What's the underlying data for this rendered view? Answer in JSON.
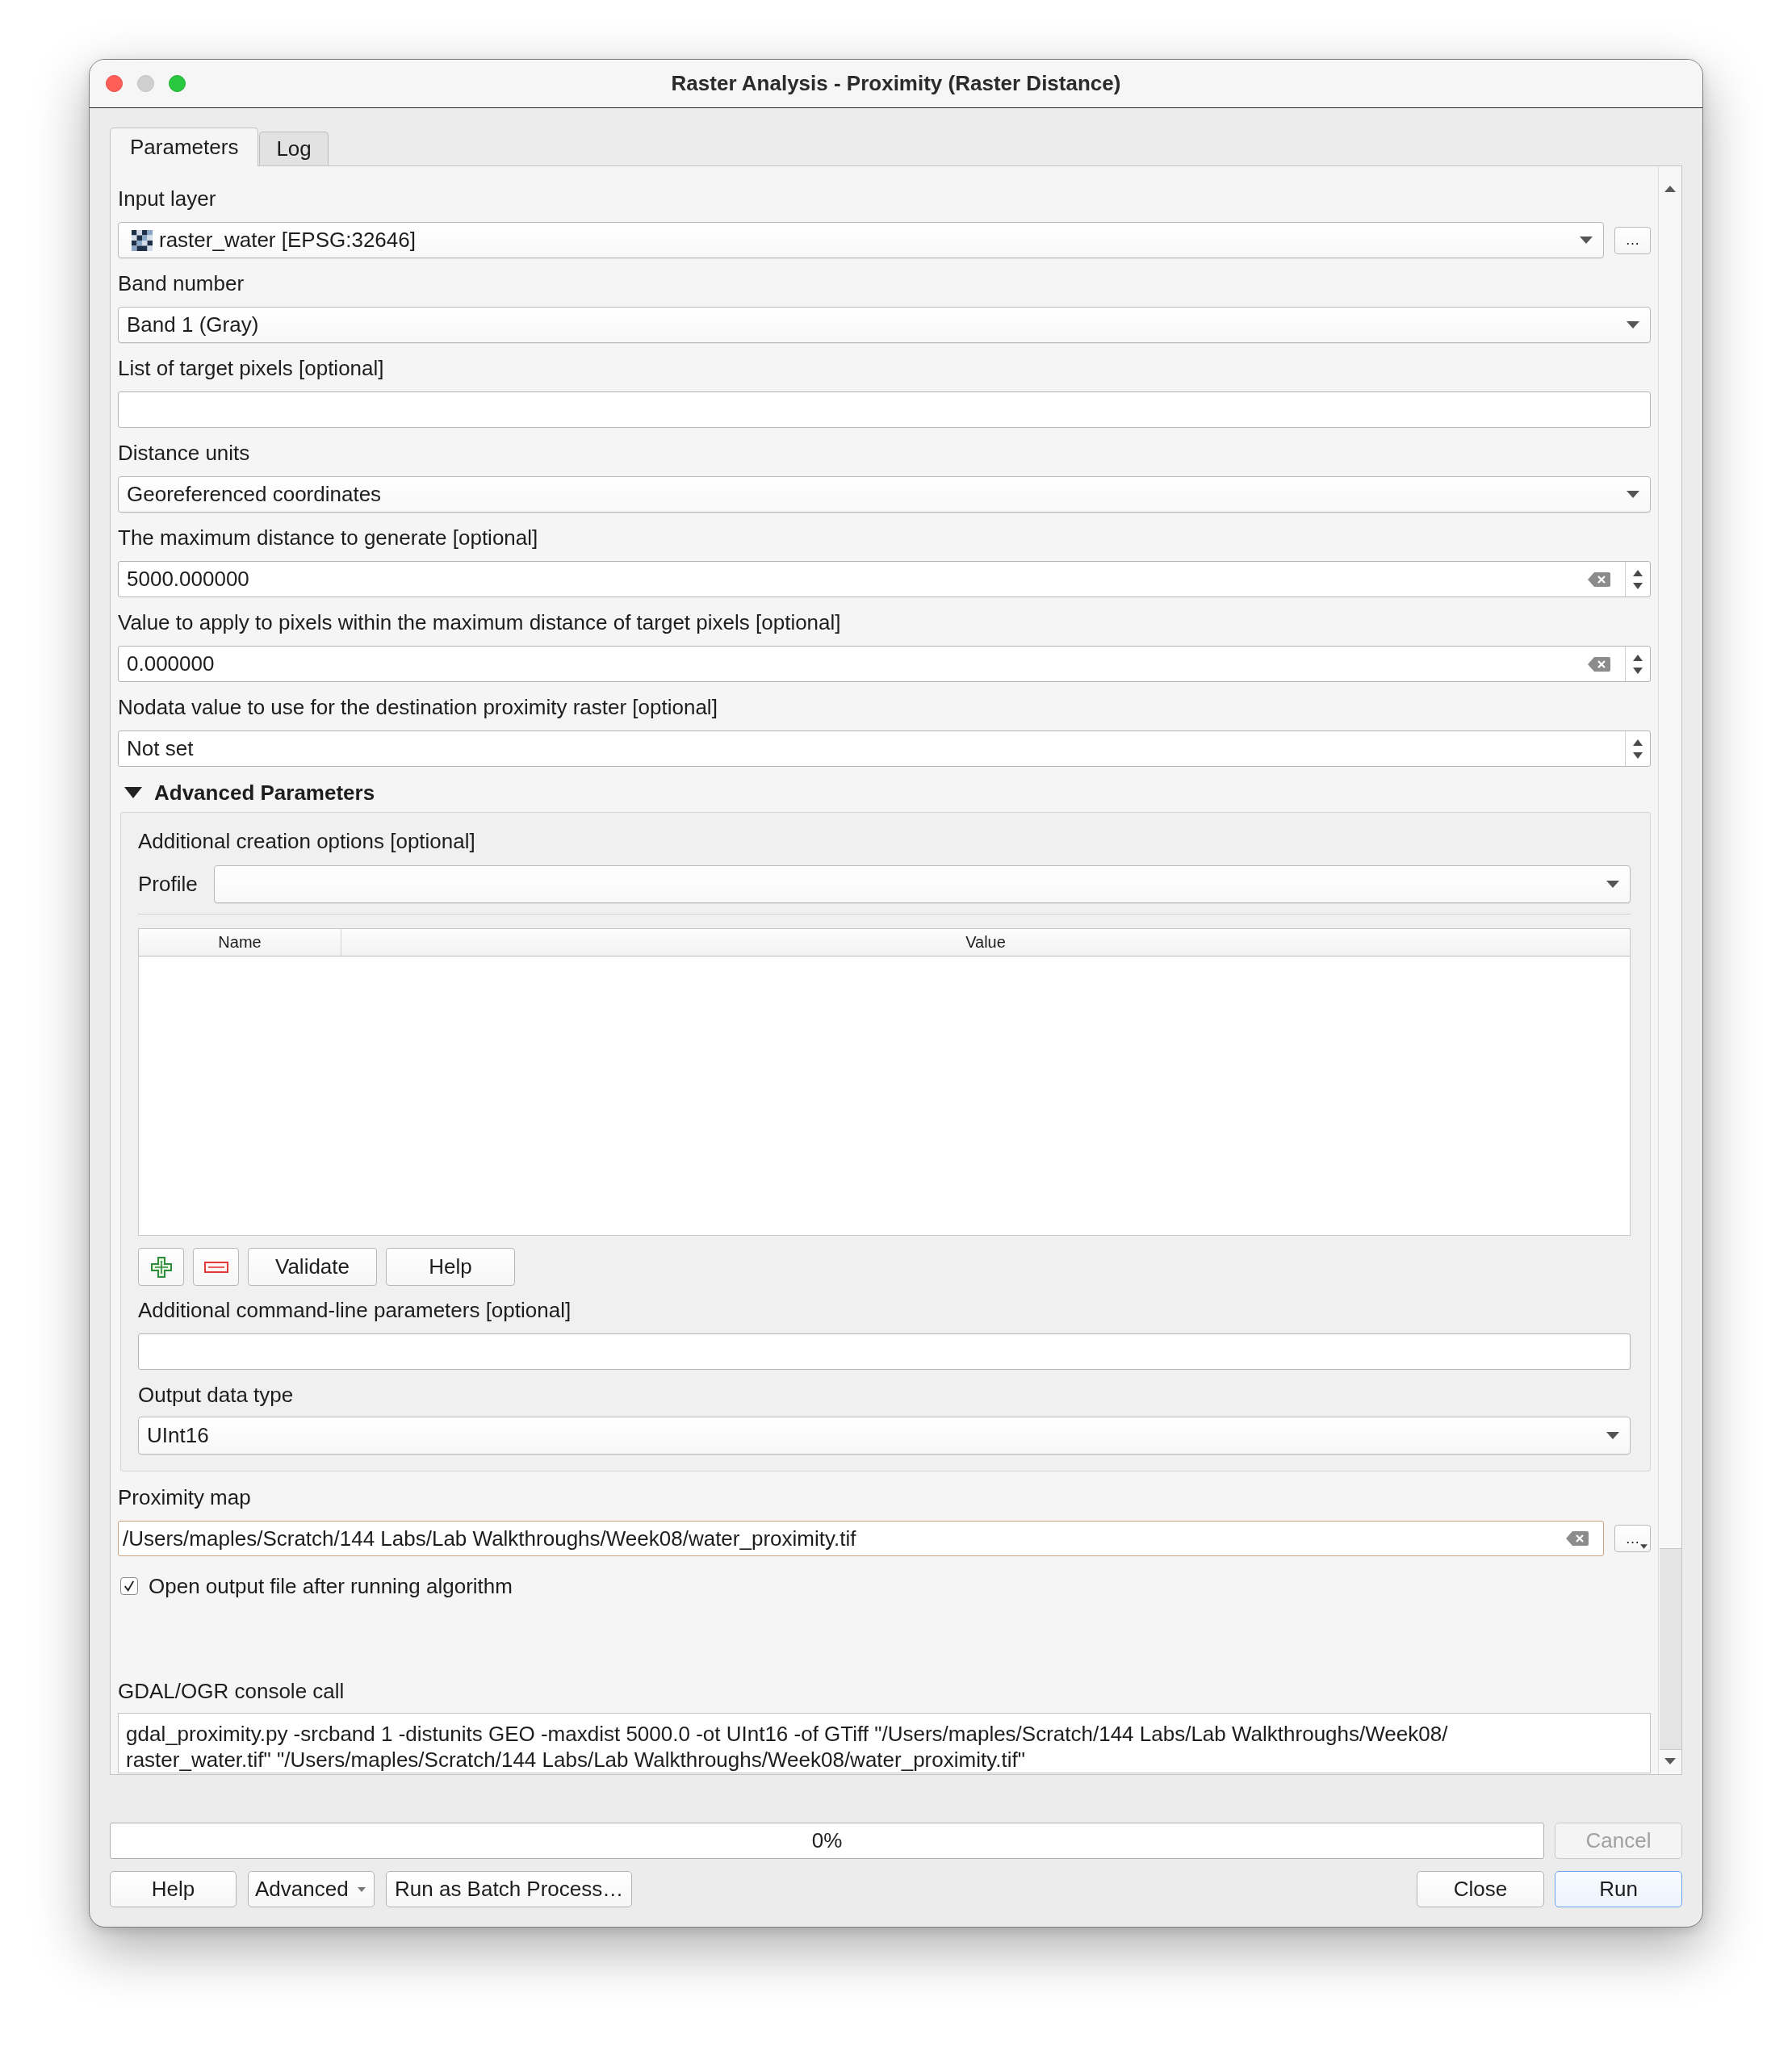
{
  "window": {
    "title": "Raster Analysis - Proximity (Raster Distance)",
    "controls": [
      {
        "kind": "close",
        "disabled": false
      },
      {
        "kind": "minimize",
        "disabled": true
      },
      {
        "kind": "zoom",
        "disabled": false
      }
    ]
  },
  "tabs": [
    {
      "label": "Parameters",
      "selected": true
    },
    {
      "label": "Log",
      "selected": false
    }
  ],
  "parameters": [
    {
      "kind": "layer",
      "label": "Input layer",
      "value": "raster_water [EPSG:32646]",
      "browse_button": {
        "label": "…",
        "menu": false
      }
    },
    {
      "kind": "combo",
      "label": "Band number",
      "value": "Band 1 (Gray)"
    },
    {
      "kind": "text",
      "label": "List of target pixels [optional]"
    },
    {
      "kind": "combo",
      "label": "Distance units",
      "value": "Georeferenced coordinates"
    },
    {
      "kind": "spin",
      "label": "The maximum distance to generate [optional]",
      "value": "5000.000000",
      "clearable": true
    },
    {
      "kind": "spin",
      "label": "Value to apply to pixels within the maximum distance of target pixels [optional]",
      "value": "0.000000",
      "clearable": true
    },
    {
      "kind": "spin",
      "label": "Nodata value to use for the destination proximity raster [optional]",
      "value": "Not set",
      "clearable": false
    }
  ],
  "advanced": {
    "title": "Advanced Parameters",
    "expanded": true,
    "creation_options": {
      "label": "Additional creation options [optional]",
      "profile_label": "Profile",
      "columns": [
        "Name",
        "Value"
      ],
      "buttons": [
        {
          "kind": "add"
        },
        {
          "kind": "remove"
        },
        {
          "kind": "text",
          "label": "Validate"
        },
        {
          "kind": "text",
          "label": "Help"
        }
      ]
    },
    "command_line": {
      "label": "Additional command-line parameters [optional]"
    },
    "output_type": {
      "label": "Output data type",
      "value": "UInt16"
    }
  },
  "output": {
    "label": "Proximity map",
    "value": "/Users/maples/Scratch/144 Labs/Lab Walkthroughs/Week08/water_proximity.tif",
    "focused": true,
    "browse_button": {
      "label": "…",
      "menu": true
    },
    "open_after": {
      "label": "Open output file after running algorithm",
      "checked": true
    }
  },
  "console": {
    "label": "GDAL/OGR console call",
    "lines": [
      "gdal_proximity.py -srcband 1 -distunits GEO -maxdist 5000.0 -ot UInt16 -of GTiff \"/Users/maples/Scratch/144 Labs/Lab Walkthroughs/Week08/",
      "raster_water.tif\" \"/Users/maples/Scratch/144 Labs/Lab Walkthroughs/Week08/water_proximity.tif\""
    ]
  },
  "progress": {
    "level": 0,
    "reading": "0%",
    "cancel": {
      "label": "Cancel",
      "disabled": true
    }
  },
  "buttons_left": [
    {
      "label": "Help",
      "menu": false
    },
    {
      "label": "Advanced",
      "menu": true
    },
    {
      "label": "Run as Batch Process…",
      "menu": false
    }
  ],
  "buttons_right": [
    {
      "label": "Close",
      "default": false
    },
    {
      "label": "Run",
      "default": true
    }
  ]
}
